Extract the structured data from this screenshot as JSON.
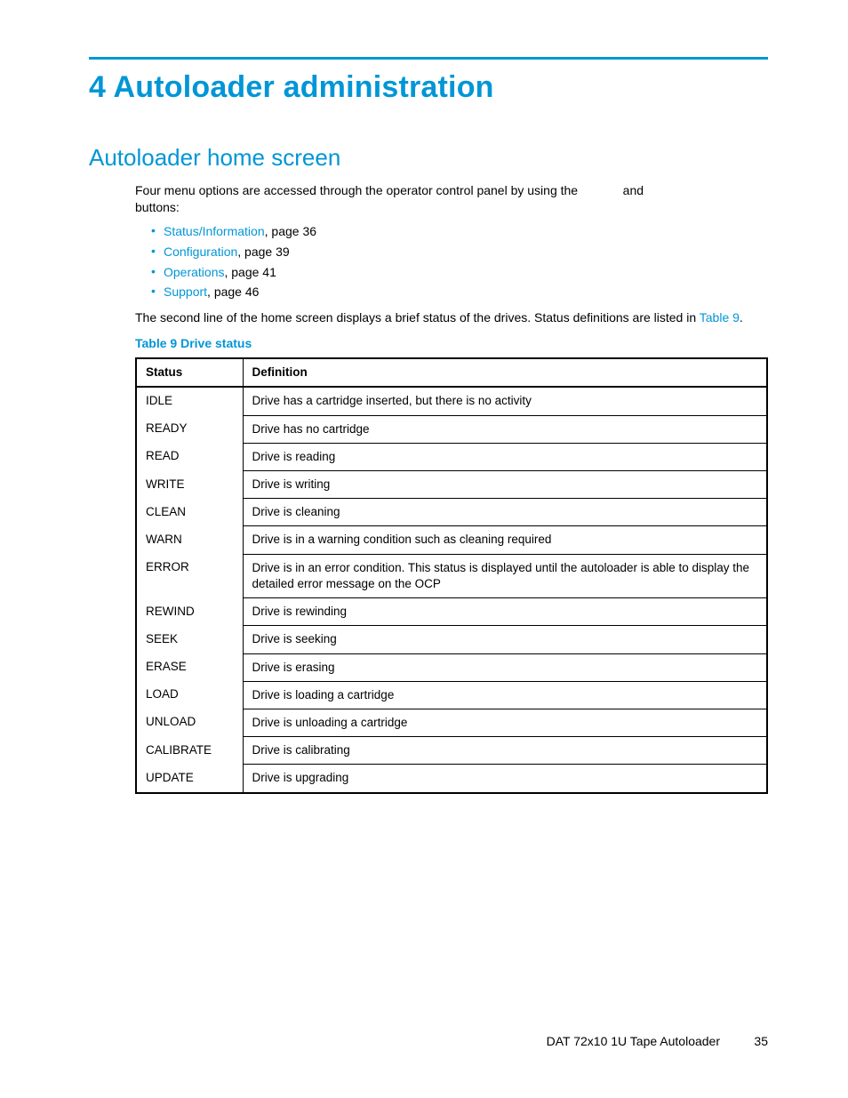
{
  "chapter_title": "4 Autoloader administration",
  "section_title": "Autoloader home screen",
  "intro_prefix": "Four menu options are accessed through the operator control panel by using the",
  "intro_middle": "and",
  "intro_suffix": "buttons:",
  "menu_links": [
    {
      "label": "Status/Information",
      "suffix": ", page 36"
    },
    {
      "label": "Configuration",
      "suffix": ", page 39"
    },
    {
      "label": "Operations",
      "suffix": ", page 41"
    },
    {
      "label": "Support",
      "suffix": ", page 46"
    }
  ],
  "second_para_prefix": "The second line of the home screen displays a brief status of the drives.  Status definitions are listed in ",
  "second_para_link": "Table 9",
  "second_para_suffix": ".",
  "table_caption": "Table 9 Drive status",
  "table_headers": {
    "status": "Status",
    "definition": "Definition"
  },
  "table_rows": [
    {
      "status": "IDLE",
      "definition": "Drive has a cartridge inserted, but there is no activity"
    },
    {
      "status": "READY",
      "definition": "Drive has no cartridge"
    },
    {
      "status": "READ",
      "definition": "Drive is reading"
    },
    {
      "status": "WRITE",
      "definition": "Drive is writing"
    },
    {
      "status": "CLEAN",
      "definition": "Drive is cleaning"
    },
    {
      "status": "WARN",
      "definition": "Drive is in a warning condition such as cleaning required"
    },
    {
      "status": "ERROR",
      "definition": "Drive is in an error condition.  This status is displayed until the autoloader is able to display the detailed error message on the OCP"
    },
    {
      "status": "REWIND",
      "definition": "Drive is rewinding"
    },
    {
      "status": "SEEK",
      "definition": "Drive is seeking"
    },
    {
      "status": "ERASE",
      "definition": "Drive is erasing"
    },
    {
      "status": "LOAD",
      "definition": "Drive is loading a cartridge"
    },
    {
      "status": "UNLOAD",
      "definition": "Drive is unloading a cartridge"
    },
    {
      "status": "CALIBRATE",
      "definition": "Drive is calibrating"
    },
    {
      "status": "UPDATE",
      "definition": "Drive is upgrading"
    }
  ],
  "footer_doc": "DAT 72x10 1U Tape Autoloader",
  "footer_page": "35"
}
